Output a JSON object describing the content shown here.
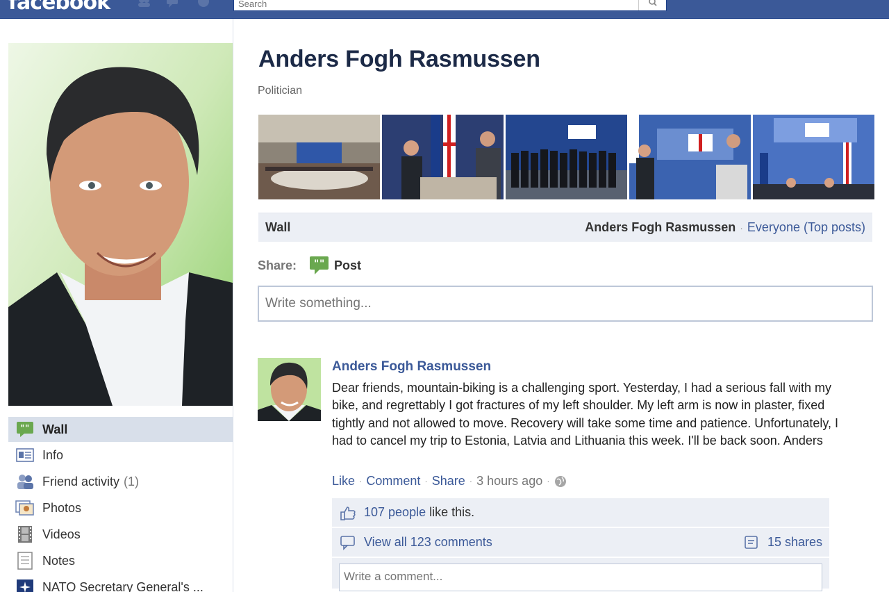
{
  "topbar": {
    "logo": "facebook",
    "search_placeholder": "Search"
  },
  "profile": {
    "name": "Anders Fogh Rasmussen",
    "category": "Politician"
  },
  "nav": {
    "items": [
      {
        "label": "Wall",
        "icon": "wall-speech-icon",
        "active": true
      },
      {
        "label": "Info",
        "icon": "info-icon"
      },
      {
        "label": "Friend activity",
        "count": "(1)",
        "icon": "friends-icon"
      },
      {
        "label": "Photos",
        "icon": "photos-icon"
      },
      {
        "label": "Videos",
        "icon": "film-icon"
      },
      {
        "label": "Notes",
        "icon": "notes-icon"
      },
      {
        "label": "NATO Secretary General's ...",
        "icon": "nato-icon"
      }
    ]
  },
  "wall_bar": {
    "title": "Wall",
    "owner": "Anders Fogh Rasmussen",
    "separator": "·",
    "filter": "Everyone (Top posts)"
  },
  "share": {
    "label": "Share:",
    "post_label": "Post",
    "composer_placeholder": "Write something..."
  },
  "story": {
    "author": "Anders Fogh Rasmussen",
    "text": "Dear friends, mountain-biking is a challenging sport. Yesterday, I had a serious fall with my bike, and regrettably I got fractures of my left shoulder. My left arm is now in plaster, fixed tightly and not allowed to move. Recovery will take some time and patience. Unfortunately, I had to cancel my trip to Estonia, Latvia and Lithuania this week. I'll be back soon. Anders",
    "actions": {
      "like": "Like",
      "comment": "Comment",
      "share": "Share",
      "time": "3 hours ago",
      "sep": "·"
    },
    "likes": {
      "link": "107 people",
      "suffix": " like this."
    },
    "comments": {
      "link": "View all 123 comments"
    },
    "shares": {
      "link": "15 shares"
    },
    "comment_placeholder": "Write a comment..."
  },
  "colors": {
    "brand": "#3b5998",
    "link": "#3b5998",
    "nav_active": "#d8dfea",
    "ufi_bg": "#eceff5"
  }
}
